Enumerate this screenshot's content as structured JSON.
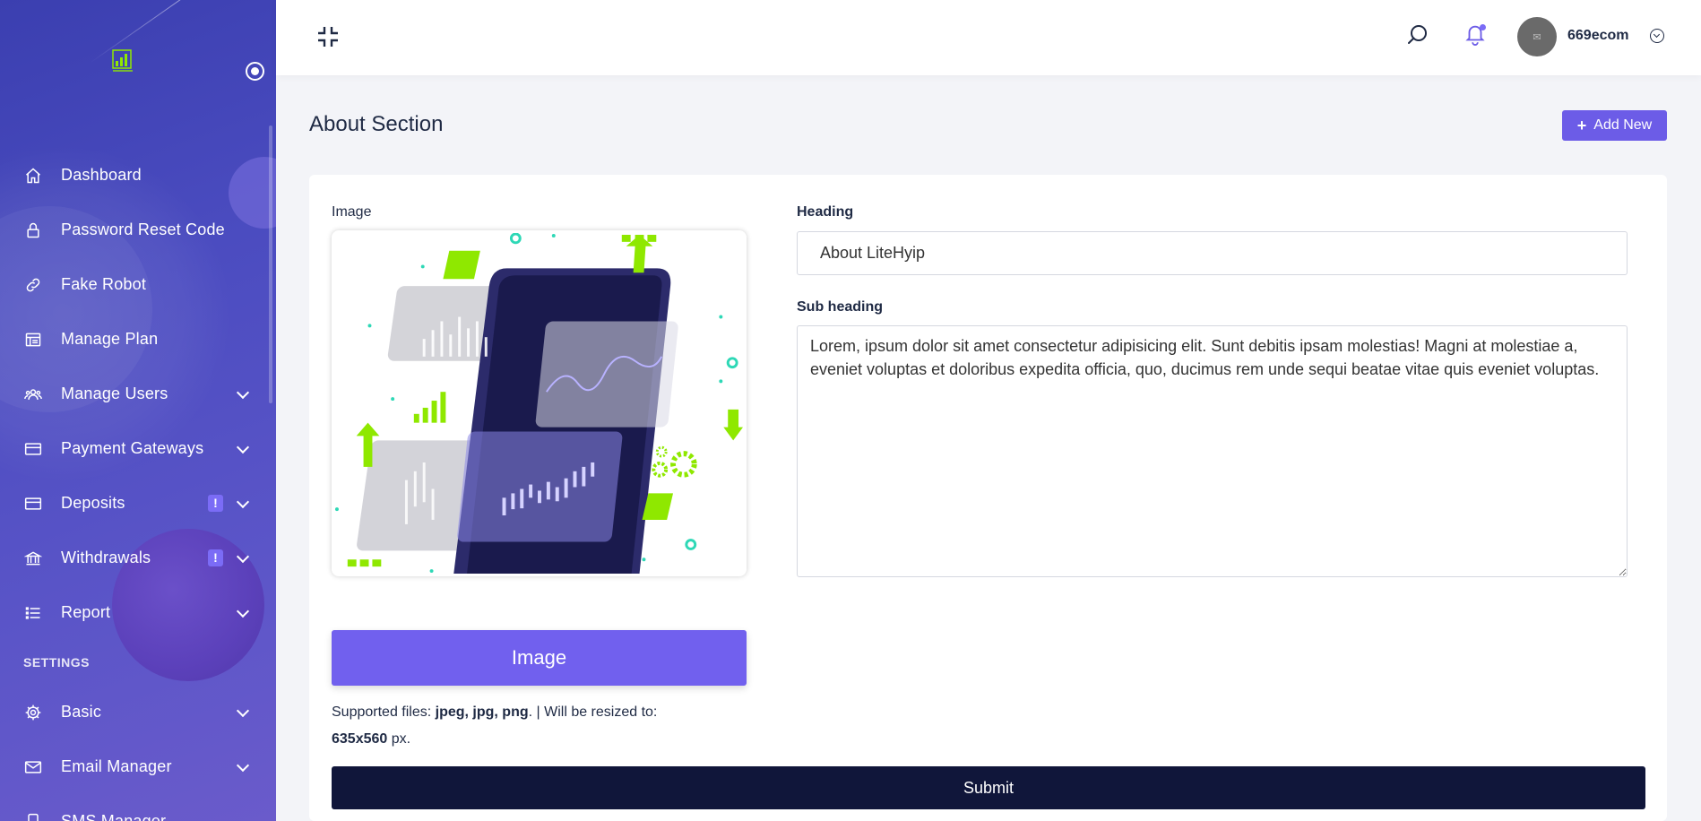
{
  "sidebar": {
    "items": [
      {
        "label": "Dashboard",
        "icon": "home-icon"
      },
      {
        "label": "Password Reset Code",
        "icon": "lock-icon"
      },
      {
        "label": "Fake Robot",
        "icon": "link-icon"
      },
      {
        "label": "Manage Plan",
        "icon": "plan-icon"
      },
      {
        "label": "Manage Users",
        "icon": "users-icon"
      },
      {
        "label": "Payment Gateways",
        "icon": "card-icon"
      },
      {
        "label": "Deposits",
        "icon": "card-icon",
        "badge": "!"
      },
      {
        "label": "Withdrawals",
        "icon": "bank-icon",
        "badge": "!"
      },
      {
        "label": "Report",
        "icon": "list-icon"
      }
    ],
    "settings_section": "SETTINGS",
    "settings_items": [
      {
        "label": "Basic",
        "icon": "gear-icon"
      },
      {
        "label": "Email Manager",
        "icon": "mail-icon"
      },
      {
        "label": "SMS Manager",
        "icon": "phone-icon"
      }
    ]
  },
  "header": {
    "username": "669ecom"
  },
  "page": {
    "title": "About Section",
    "add_new_label": "Add New"
  },
  "form": {
    "image_label": "Image",
    "image_button": "Image",
    "supported_prefix": "Supported files: ",
    "supported_types": "jpeg, jpg, png",
    "supported_mid": ". | Will be resized to: ",
    "supported_size": "635x560",
    "supported_suffix": " px.",
    "heading_label": "Heading",
    "heading_value": "About LiteHyip",
    "subheading_label": "Sub heading",
    "subheading_value": "Lorem, ipsum dolor sit amet consectetur adipisicing elit. Sunt debitis ipsam molestias! Magni at molestiae a, eveniet voluptas et doloribus expedita officia, quo, ducimus rem unde sequi beatae vitae quis eveniet voluptas.",
    "submit_label": "Submit"
  },
  "colors": {
    "accent": "#6c5ce7",
    "submit": "#10163a",
    "sidebar_start": "#3b3fb0",
    "sidebar_end": "#6a5bcb",
    "lime": "#8fe800"
  }
}
